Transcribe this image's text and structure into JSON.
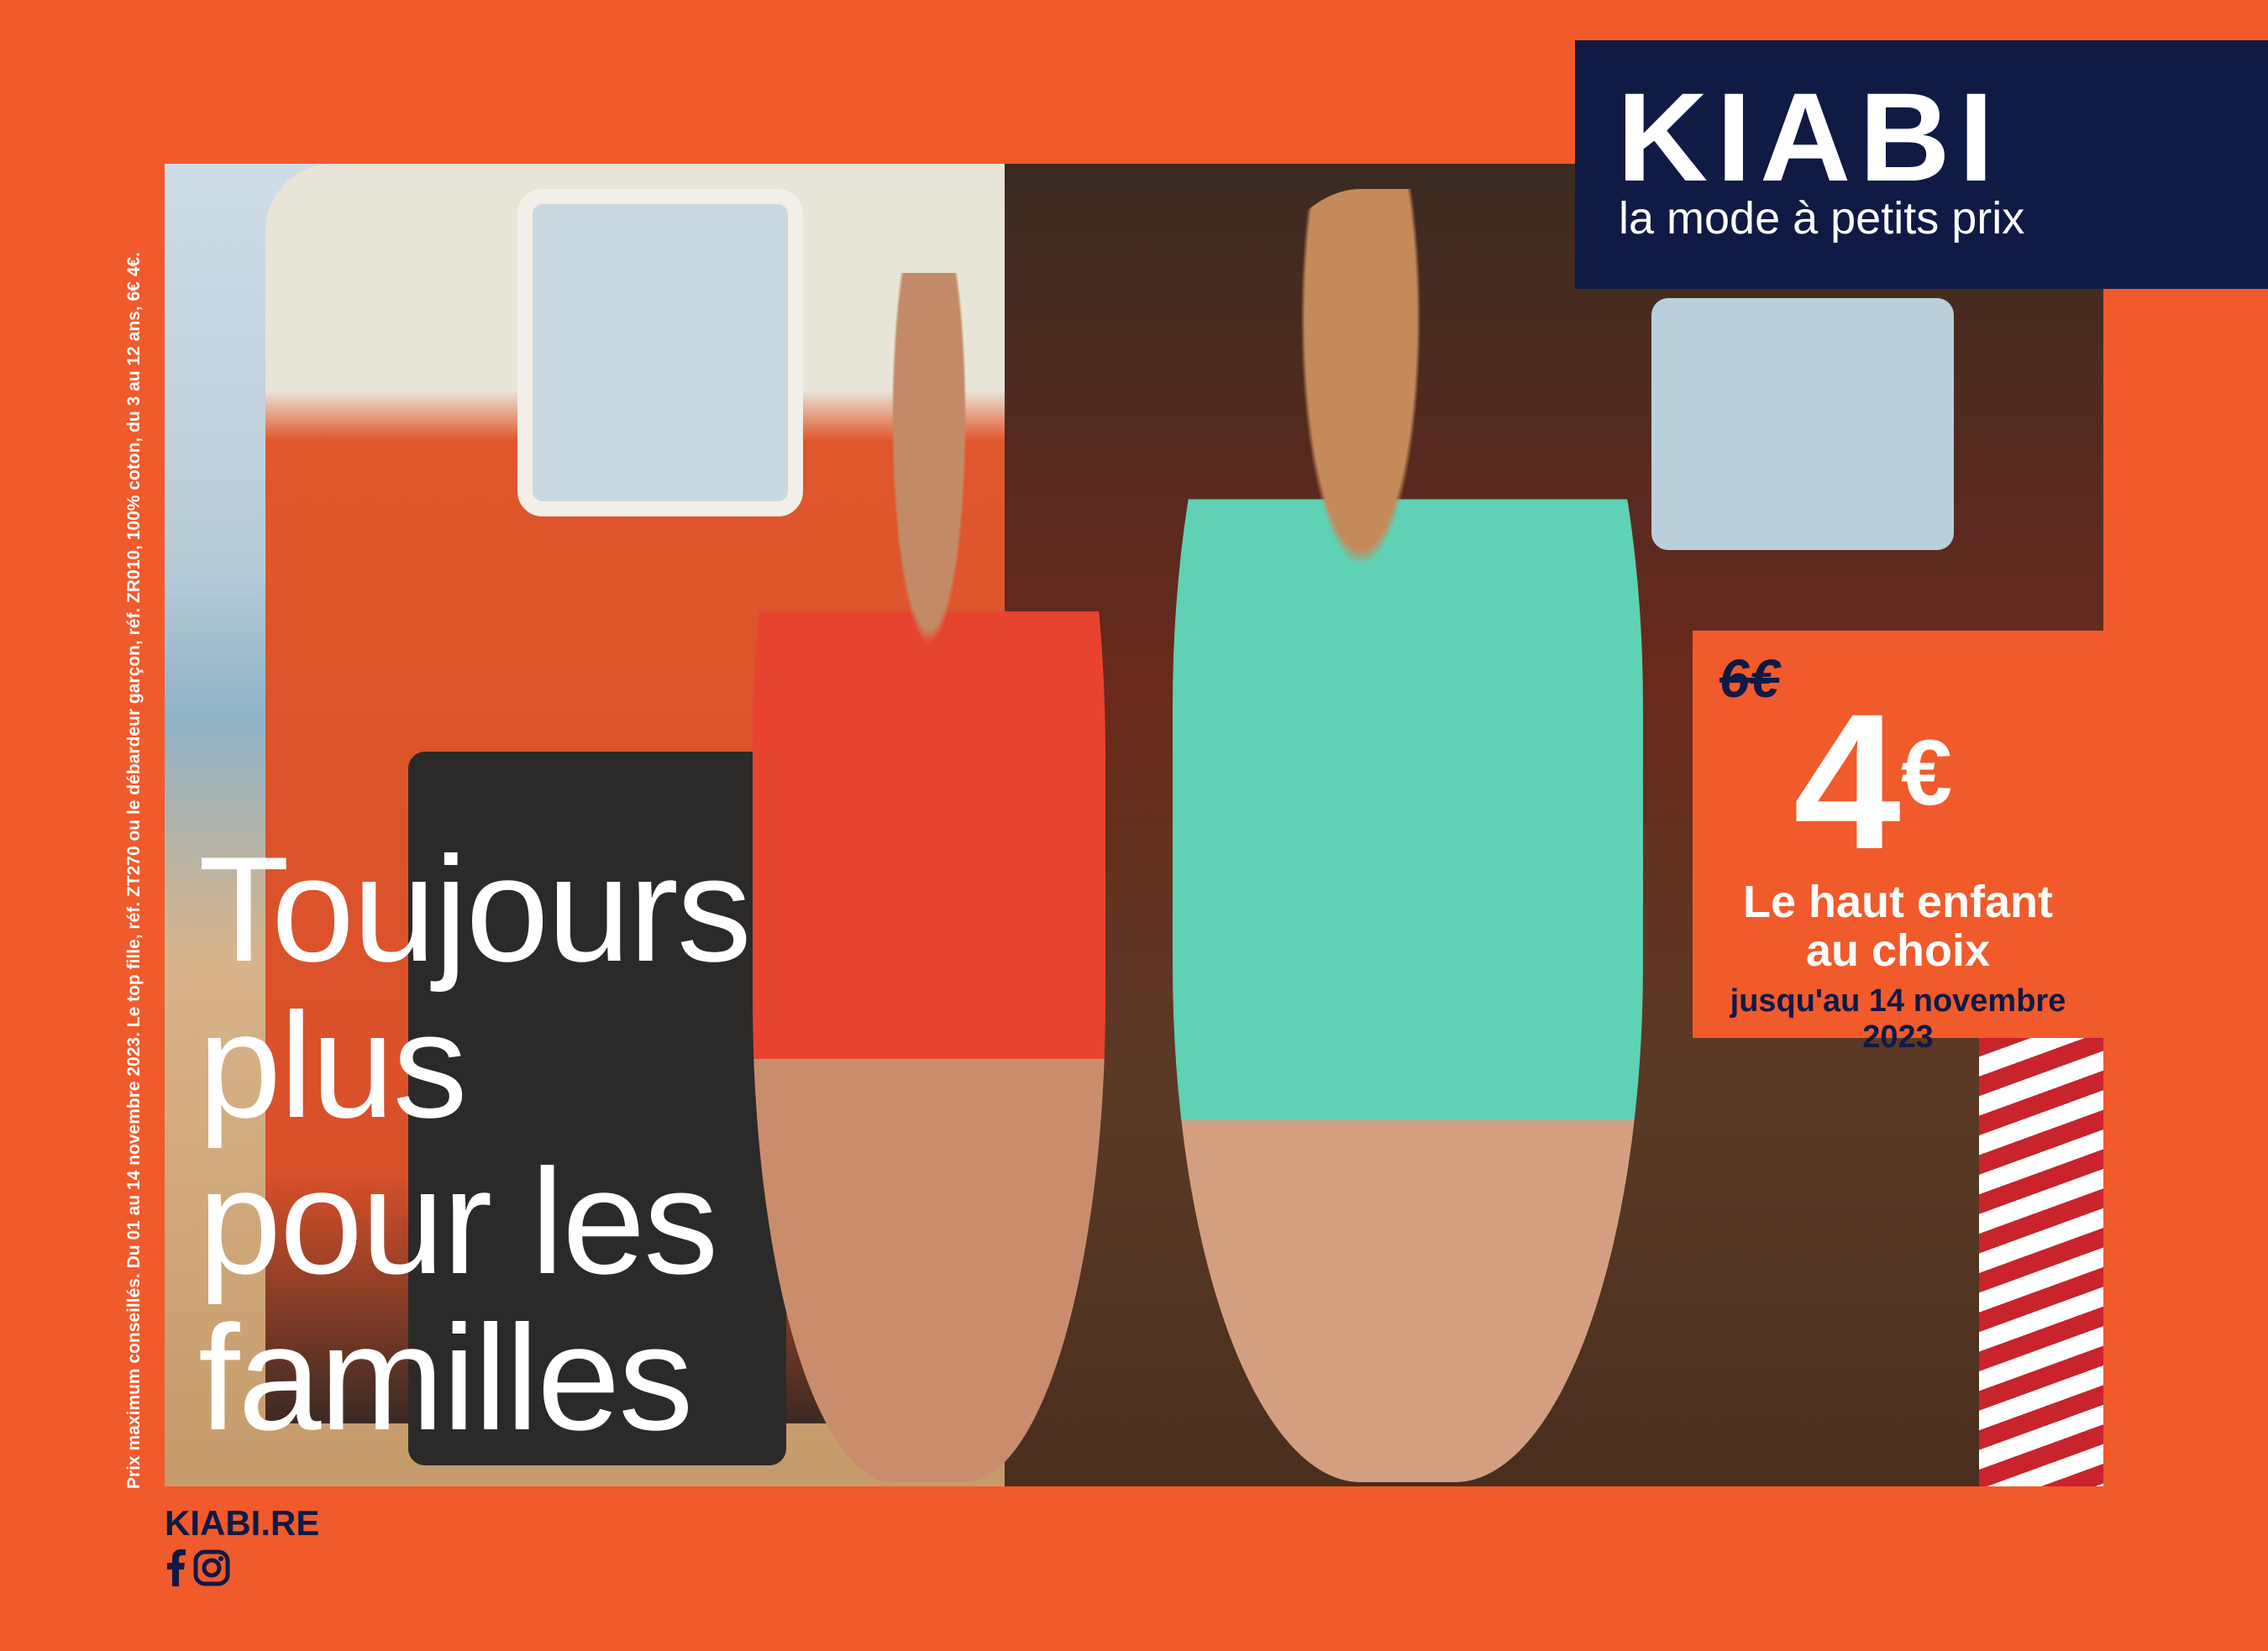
{
  "legal_text": "Prix maximum conseillés. Du 01 au 14 novembre 2023. Le top fille, réf. ZT270 ou le débardeur garçon, réf. ZR010, 100% coton, du 3 au 12 ans, 6€ 4€.",
  "headline": [
    "Toujours",
    "plus",
    "pour les",
    "familles"
  ],
  "logo": {
    "brand": "KIABI",
    "tagline": "la mode à petits prix"
  },
  "price": {
    "old": "6€",
    "new": "4",
    "currency": "€",
    "description": [
      "Le haut enfant",
      "au choix"
    ],
    "validity": "jusqu'au 14 novembre 2023"
  },
  "footer": {
    "website": "KIABI.RE",
    "social": [
      "facebook-icon",
      "instagram-icon"
    ]
  },
  "colors": {
    "orange": "#f15a2b",
    "navy": "#0f1a45"
  }
}
